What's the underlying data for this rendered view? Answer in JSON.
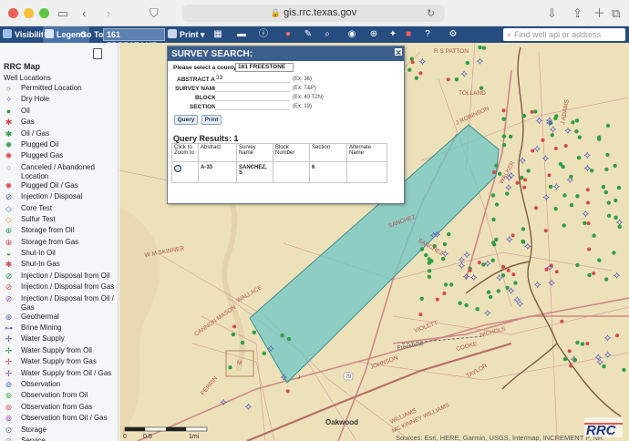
{
  "browser": {
    "url": "gis.rrc.texas.gov"
  },
  "toolbar": {
    "visibility_label": "Visibility",
    "legend_label": "Legend",
    "goto_label": "Go To:",
    "goto_value": "161 FREESTONE",
    "print_label": "Print",
    "search_placeholder": "Find well api or address"
  },
  "sidebar": {
    "title": "RRC Map",
    "section": "Well Locations",
    "items": [
      {
        "label": "Permitted Location",
        "symbol": "○",
        "color": "#4a5fa8"
      },
      {
        "label": "Dry Hole",
        "symbol": "✧",
        "color": "#4a5fa8"
      },
      {
        "label": "Oil",
        "symbol": "●",
        "color": "#2f9e44"
      },
      {
        "label": "Gas",
        "symbol": "✱",
        "color": "#d8474a"
      },
      {
        "label": "Oil / Gas",
        "symbol": "✱",
        "color": "#2f9e44"
      },
      {
        "label": "Plugged Oil",
        "symbol": "✺",
        "color": "#2f9e44"
      },
      {
        "label": "Plugged Gas",
        "symbol": "✺",
        "color": "#d8474a"
      },
      {
        "label": "Canceled / Abandoned Location",
        "symbol": "○",
        "color": "#777777"
      },
      {
        "label": "Plugged Oil / Gas",
        "symbol": "✺",
        "color": "#d8474a"
      },
      {
        "label": "Injection / Disposal",
        "symbol": "⊘",
        "color": "#4a5fa8"
      },
      {
        "label": "Core Test",
        "symbol": "◇",
        "color": "#4a5fa8"
      },
      {
        "label": "Sulfur Test",
        "symbol": "◇",
        "color": "#c9a000"
      },
      {
        "label": "Storage from Oil",
        "symbol": "⊕",
        "color": "#2f9e44"
      },
      {
        "label": "Storage from Gas",
        "symbol": "⊕",
        "color": "#d8474a"
      },
      {
        "label": "Shut-In Oil",
        "symbol": "◒",
        "color": "#2f9e44"
      },
      {
        "label": "Shut-In Gas",
        "symbol": "✱",
        "color": "#d8474a"
      },
      {
        "label": "Injection / Disposal from Oil",
        "symbol": "⊘",
        "color": "#2f9e44"
      },
      {
        "label": "Injection / Disposal from Gas",
        "symbol": "⊘",
        "color": "#d8474a"
      },
      {
        "label": "Injection / Disposal from Oil / Gas",
        "symbol": "⊘",
        "color": "#8a4aa8"
      },
      {
        "label": "Geothermal",
        "symbol": "⊛",
        "color": "#4a5fa8"
      },
      {
        "label": "Brine Mining",
        "symbol": "⊶",
        "color": "#4a5fa8"
      },
      {
        "label": "Water Supply",
        "symbol": "✢",
        "color": "#4a5fa8"
      },
      {
        "label": "Water Supply from Oil",
        "symbol": "✢",
        "color": "#2f9e44"
      },
      {
        "label": "Water Supply from Gas",
        "symbol": "✢",
        "color": "#d8474a"
      },
      {
        "label": "Water Supply from Oil / Gas",
        "symbol": "✢",
        "color": "#8a4aa8"
      },
      {
        "label": "Observation",
        "symbol": "⊚",
        "color": "#4a5fa8"
      },
      {
        "label": "Observation from Oil",
        "symbol": "⊚",
        "color": "#2f9e44"
      },
      {
        "label": "Observation from Gas",
        "symbol": "⊚",
        "color": "#d8474a"
      },
      {
        "label": "Observation from Oil / Gas",
        "symbol": "⊚",
        "color": "#8a4aa8"
      },
      {
        "label": "Storage",
        "symbol": "⊙",
        "color": "#4a5fa8"
      },
      {
        "label": "Service",
        "symbol": "⊙",
        "color": "#777777"
      }
    ]
  },
  "dialog": {
    "title": "SURVEY SEARCH:",
    "county_label": "Please select a county:",
    "county_value": "161 FREESTONE",
    "abstract_label": "ABSTRACT A-",
    "abstract_value": "33",
    "abstract_example": "(Ex: 36)",
    "survey_label": "SURVEY NAME",
    "survey_example": "(Ex: T&P)",
    "block_label": "BLOCK",
    "block_example": "(Ex: 40 T2N)",
    "section_label": "SECTION",
    "section_example": "(Ex: 19)",
    "query_button": "Query",
    "print_button": "Print",
    "results_title": "Query Results:",
    "results_count": "1",
    "columns": [
      "Click to Zoom to",
      "Abstract",
      "Survey Name",
      "Block Number",
      "Section",
      "Alternate Name"
    ],
    "rows": [
      {
        "abstract": "A-33",
        "survey_name": "SANCHEZ, S",
        "block": "",
        "section": "6",
        "alternate": ""
      }
    ]
  },
  "map": {
    "place_labels": [
      "R S PATTON",
      "J ROBINSON",
      "WALKER",
      "TOLLAND",
      "J ADAMS",
      "SANCHEZ",
      "W M SKINNER",
      "WALLACE",
      "CANNON MASON",
      "PERRIN",
      "VIOLETT",
      "COOKE",
      "NICHOLS",
      "JOHNSON",
      "TAYLOR",
      "WILLIAMS",
      "MC KINNEY WILLIAMS",
      "J",
      "Oakwood",
      "M",
      "Freestone"
    ],
    "road_labels": [
      "79"
    ],
    "scale": {
      "ticks": [
        "0",
        "0.5",
        "1mi"
      ]
    },
    "attribution": "Sources: Esri, HERE, Garmin, USGS, Intermap, INCREMENT P, NR",
    "logo_text": "RRC",
    "colors": {
      "survey_fill": "#6ec6c6",
      "survey_stroke": "#3e8e8e",
      "land": "#ede1ba",
      "road": "#d08a8a",
      "creek": "#7a5a44"
    }
  }
}
